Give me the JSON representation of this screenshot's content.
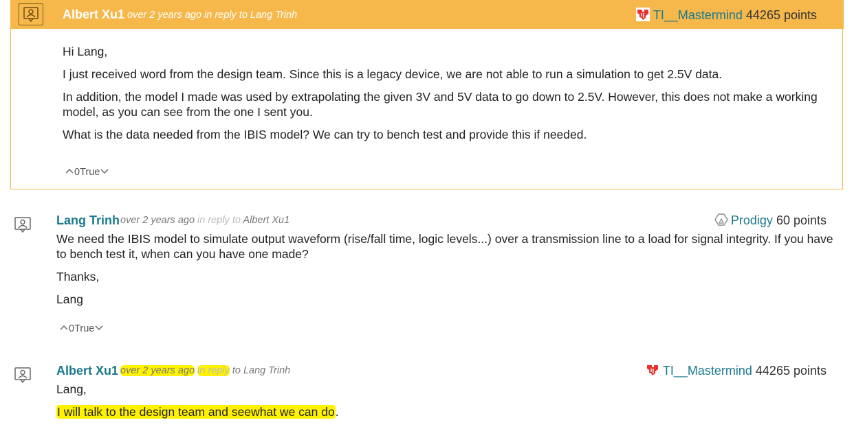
{
  "posts": [
    {
      "author": "Albert Xu1",
      "meta": "over 2 years ago in reply to Lang Trinh",
      "rank_name": "TI__Mastermind",
      "points": "44265 points",
      "paragraphs": [
        "Hi Lang,",
        "I just received word from the design team. Since this is a legacy device, we are not able to run a simulation to get 2.5V data.",
        "In addition, the model I made was used by extrapolating the given 3V and 5V data to go down to 2.5V. However, this does not make a working model, as you can see from the one I sent you.",
        "What is the data needed from the IBIS model? We can try to bench test and provide this if needed."
      ],
      "vote": "0True"
    },
    {
      "author": "Lang Trinh",
      "meta_time": "over 2 years ago",
      "meta_reply": "in reply to",
      "meta_target": "Albert Xu1",
      "rank_name": "Prodigy",
      "points": "60 points",
      "paragraphs": [
        "We need the IBIS model to simulate output waveform (rise/fall time, logic levels...) over a transmission line to a load for signal integrity. If you have to bench test it, when can you have one made?",
        "Thanks,",
        "Lang"
      ],
      "vote": "0True"
    },
    {
      "author": "Albert Xu1",
      "meta_time": "over 2 years ago",
      "meta_reply": "in reply",
      "meta_to": "to Lang Trinh",
      "rank_name": "TI__Mastermind",
      "points": "44265 points",
      "paragraphs": [
        "Lang,",
        "I will talk to the design team and seewhat we can do",
        "."
      ]
    }
  ],
  "colors": {
    "header": "#f7b84b",
    "link": "#1a7a8c",
    "highlight": "#fff200",
    "ti_red": "#e8312f"
  },
  "icons": [
    "user-avatar-icon",
    "ti-logo-icon",
    "prodigy-icon",
    "chevron-up-icon",
    "chevron-down-icon"
  ]
}
